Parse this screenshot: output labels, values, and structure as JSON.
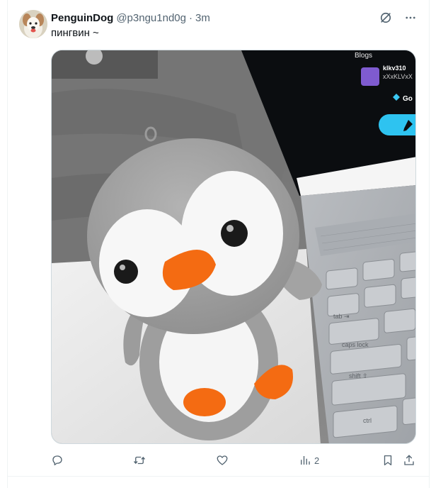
{
  "tweet": {
    "author_name": "PenguinDog",
    "handle": "@p3ngu1nd0g",
    "separator": "·",
    "time": "3m",
    "text": "пингвин ~",
    "avatar": "avatar-dog-photo",
    "media": "photo-penguin-plush-next-to-laptop"
  },
  "laptop_screen": {
    "blogs_label": "Blogs",
    "username": "klkv310",
    "subline": "xXxKLVxX",
    "go_label": "Go"
  },
  "keyboard": {
    "caps_lock": "caps lock",
    "shift": "shift ⇧",
    "ctrl": "ctrl",
    "tab": "tab ⇥"
  },
  "actions": {
    "reply_icon": "reply-icon",
    "retweet_icon": "retweet-icon",
    "like_icon": "heart-icon",
    "views_icon": "views-icon",
    "views_count": "2",
    "bookmark_icon": "bookmark-icon",
    "share_icon": "share-icon"
  },
  "icons": {
    "grok": "grok-icon",
    "more": "more-icon"
  },
  "colors": {
    "text_primary": "#0f1419",
    "text_secondary": "#536471",
    "border": "#cfd9de",
    "penguin_orange": "#f46b12",
    "laptop_accent": "#2ec3f0"
  }
}
